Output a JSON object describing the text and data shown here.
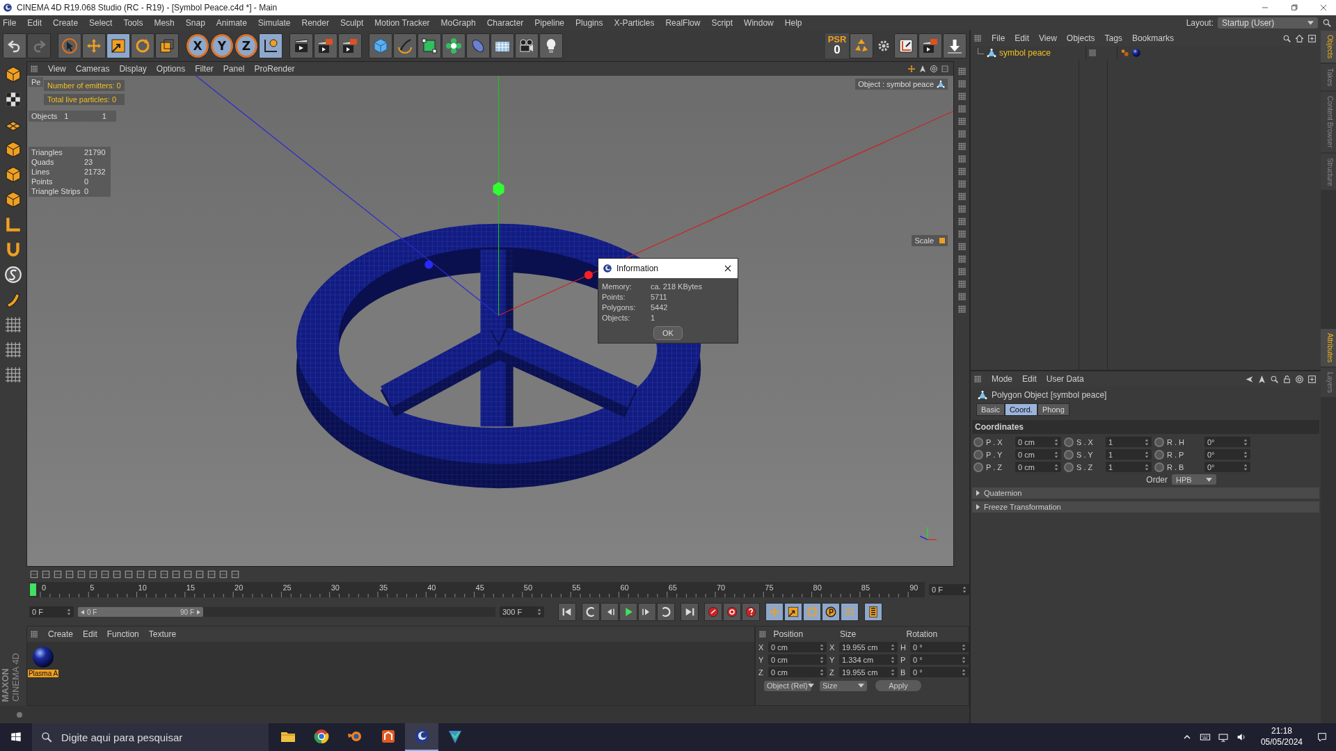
{
  "window": {
    "title": "CINEMA 4D R19.068 Studio (RC - R19) - [Symbol Peace.c4d *] - Main"
  },
  "menu_bar": [
    "File",
    "Edit",
    "Create",
    "Select",
    "Tools",
    "Mesh",
    "Snap",
    "Animate",
    "Simulate",
    "Render",
    "Sculpt",
    "Motion Tracker",
    "MoGraph",
    "Character",
    "Pipeline",
    "Plugins",
    "X-Particles",
    "RealFlow",
    "Script",
    "Window",
    "Help"
  ],
  "layout": {
    "label": "Layout:",
    "value": "Startup (User)"
  },
  "toolbar": {
    "tools": [
      {
        "selected": false
      },
      {
        "selected": false
      },
      {
        "selected": true
      },
      {
        "selected": false
      },
      {
        "selected": false
      }
    ],
    "axis_buttons": [
      {
        "label": "X",
        "on": true
      },
      {
        "label": "Y",
        "on": true
      },
      {
        "label": "Z",
        "on": true
      }
    ],
    "psr": {
      "label": "PSR",
      "value": "0"
    }
  },
  "viewport": {
    "menu": [
      "View",
      "Cameras",
      "Display",
      "Options",
      "Filter",
      "Panel",
      "ProRender"
    ],
    "hud": {
      "tag": "Pe",
      "emitters": "Number of emitters: 0",
      "particles": "Total live particles: 0",
      "objects": {
        "label": "Objects",
        "values": [
          "1",
          "1"
        ]
      },
      "stats": [
        {
          "label": "Triangles",
          "value": "21790"
        },
        {
          "label": "Quads",
          "value": "23"
        },
        {
          "label": "Lines",
          "value": "21732"
        },
        {
          "label": "Points",
          "value": "0"
        },
        {
          "label": "Triangle Strips",
          "value": "0"
        }
      ]
    },
    "object_label": "Object : symbol peace",
    "scale_label": "Scale"
  },
  "dialog": {
    "title": "Information",
    "rows": [
      {
        "label": "Memory:",
        "value": "ca. 218 KBytes"
      },
      {
        "label": "Points:",
        "value": "5711"
      },
      {
        "label": "Polygons:",
        "value": "5442"
      },
      {
        "label": "Objects:",
        "value": "1"
      }
    ],
    "button": "OK"
  },
  "object_manager": {
    "menu": [
      "File",
      "Edit",
      "View",
      "Objects",
      "Tags",
      "Bookmarks"
    ],
    "objects": [
      {
        "name": "symbol peace",
        "selected": true
      }
    ]
  },
  "attributes": {
    "menu": [
      "Mode",
      "Edit",
      "User Data"
    ],
    "title": "Polygon Object [symbol peace]",
    "tabs": [
      {
        "label": "Basic",
        "selected": false
      },
      {
        "label": "Coord.",
        "selected": true
      },
      {
        "label": "Phong",
        "selected": false
      }
    ],
    "section": "Coordinates",
    "rows": [
      {
        "p_label": "P . X",
        "p_value": "0 cm",
        "s_label": "S . X",
        "s_value": "1",
        "r_label": "R . H",
        "r_value": "0°"
      },
      {
        "p_label": "P . Y",
        "p_value": "0 cm",
        "s_label": "S . Y",
        "s_value": "1",
        "r_label": "R . P",
        "r_value": "0°"
      },
      {
        "p_label": "P . Z",
        "p_value": "0 cm",
        "s_label": "S . Z",
        "s_value": "1",
        "r_label": "R . B",
        "r_value": "0°"
      }
    ],
    "order": {
      "label": "Order",
      "value": "HPB"
    },
    "groups": [
      {
        "label": "Quaternion",
        "expanded": false
      },
      {
        "label": "Freeze Transformation",
        "expanded": false
      }
    ]
  },
  "side_tabs_top": [
    {
      "label": "Objects",
      "selected": true
    },
    {
      "label": "Takes",
      "selected": false
    },
    {
      "label": "Content Browser",
      "selected": false
    },
    {
      "label": "Structure",
      "selected": false
    }
  ],
  "side_tabs_bottom": [
    {
      "label": "Attributes",
      "selected": true
    },
    {
      "label": "Layers",
      "selected": false
    }
  ],
  "timeline": {
    "ticks": [
      "0",
      "5",
      "10",
      "15",
      "20",
      "25",
      "30",
      "35",
      "40",
      "45",
      "50",
      "55",
      "60",
      "65",
      "70",
      "75",
      "80",
      "85",
      "90"
    ],
    "current": "0 F",
    "start": "0 F",
    "range": {
      "start": "0 F",
      "end": "90 F",
      "level": 0.3
    },
    "end": "300 F",
    "key_filters": [
      {
        "on": true
      },
      {
        "on": true
      },
      {
        "on": true
      },
      {
        "on": true
      },
      {
        "on": true
      }
    ]
  },
  "material_manager": {
    "menu": [
      "Create",
      "Edit",
      "Function",
      "Texture"
    ],
    "materials": [
      {
        "name": "Plasma A",
        "selected": true
      }
    ]
  },
  "coordinates": {
    "headers": [
      "Position",
      "Size",
      "Rotation"
    ],
    "rows": [
      {
        "pos_axis": "X",
        "pos": "0 cm",
        "size_axis": "X",
        "size": "19.955 cm",
        "rot_axis": "H",
        "rot": "0 °"
      },
      {
        "pos_axis": "Y",
        "pos": "0 cm",
        "size_axis": "Y",
        "size": "1.334 cm",
        "rot_axis": "P",
        "rot": "0 °"
      },
      {
        "pos_axis": "Z",
        "pos": "0 cm",
        "size_axis": "Z",
        "size": "19.955 cm",
        "rot_axis": "B",
        "rot": "0 °"
      }
    ],
    "mode": "Object (Rel)",
    "size_mode": "Size",
    "button": "Apply"
  },
  "brand": {
    "company": "MAXON",
    "product": "CINEMA 4D"
  },
  "taskbar": {
    "search_placeholder": "Digite aqui para pesquisar",
    "apps": [
      {
        "selected": false
      },
      {
        "selected": false
      },
      {
        "selected": false
      },
      {
        "selected": false
      },
      {
        "selected": true
      },
      {
        "selected": false
      }
    ],
    "time": "21:18",
    "date": "05/05/2024"
  }
}
